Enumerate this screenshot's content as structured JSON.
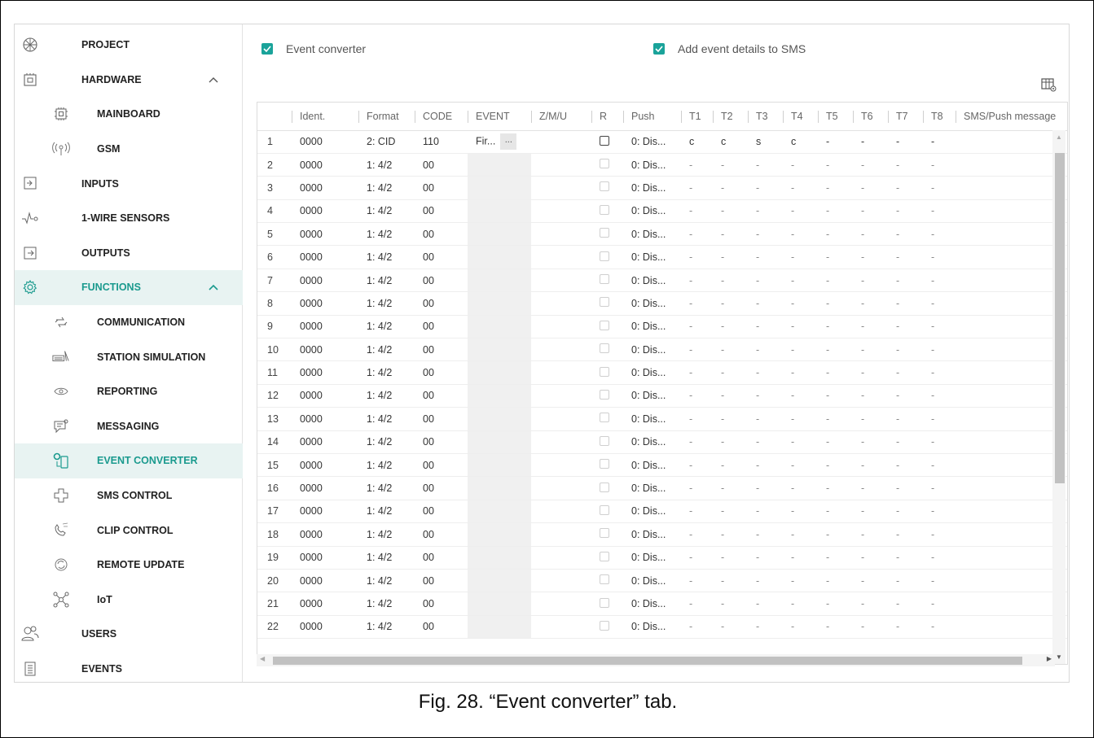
{
  "sidebar": {
    "items": [
      {
        "label": "PROJECT",
        "icon": "project-icon",
        "level": "top"
      },
      {
        "label": "HARDWARE",
        "icon": "hardware-icon",
        "level": "top",
        "expanded": true
      },
      {
        "label": "MAINBOARD",
        "icon": "mainboard-icon",
        "level": "sub"
      },
      {
        "label": "GSM",
        "icon": "gsm-antenna-icon",
        "level": "sub"
      },
      {
        "label": "INPUTS",
        "icon": "inputs-icon",
        "level": "top"
      },
      {
        "label": "1-WIRE SENSORS",
        "icon": "sensor-icon",
        "level": "top"
      },
      {
        "label": "OUTPUTS",
        "icon": "outputs-icon",
        "level": "top"
      },
      {
        "label": "FUNCTIONS",
        "icon": "gear-icon",
        "level": "top",
        "expanded": true,
        "active": true
      },
      {
        "label": "COMMUNICATION",
        "icon": "communication-icon",
        "level": "sub"
      },
      {
        "label": "STATION SIMULATION",
        "icon": "station-icon",
        "level": "sub"
      },
      {
        "label": "REPORTING",
        "icon": "eye-icon",
        "level": "sub"
      },
      {
        "label": "MESSAGING",
        "icon": "message-icon",
        "level": "sub"
      },
      {
        "label": "EVENT CONVERTER",
        "icon": "event-converter-icon",
        "level": "sub",
        "active": true
      },
      {
        "label": "SMS CONTROL",
        "icon": "sms-control-icon",
        "level": "sub"
      },
      {
        "label": "CLIP CONTROL",
        "icon": "clip-control-icon",
        "level": "sub"
      },
      {
        "label": "REMOTE UPDATE",
        "icon": "remote-update-icon",
        "level": "sub"
      },
      {
        "label": "IoT",
        "icon": "iot-icon",
        "level": "sub"
      },
      {
        "label": "USERS",
        "icon": "users-icon",
        "level": "top"
      },
      {
        "label": "EVENTS",
        "icon": "events-icon",
        "level": "top"
      }
    ]
  },
  "options": {
    "event_converter_label": "Event converter",
    "event_converter_checked": true,
    "add_details_label": "Add event details to SMS",
    "add_details_checked": true
  },
  "grid": {
    "columns": [
      "",
      "Ident.",
      "Format",
      "CODE",
      "EVENT",
      "Z/M/U",
      "R",
      "Push",
      "T1",
      "T2",
      "T3",
      "T4",
      "T5",
      "T6",
      "T7",
      "T8",
      "SMS/Push message"
    ],
    "first_row": {
      "num": "1",
      "ident": "0000",
      "format": "2: CID",
      "code": "110",
      "event": "Fir...",
      "event_btn": "...",
      "push": "0: Dis...",
      "t": [
        "c",
        "c",
        "s",
        "c",
        "-",
        "-",
        "-",
        "-"
      ]
    },
    "default_row": {
      "ident": "0000",
      "format": "1: 4/2",
      "code": "00",
      "push": "0: Dis...",
      "t": [
        "-",
        "-",
        "-",
        "-",
        "-",
        "-",
        "-",
        "-"
      ]
    },
    "row_numbers": [
      "2",
      "3",
      "4",
      "5",
      "6",
      "7",
      "8",
      "9",
      "10",
      "11",
      "12",
      "13",
      "14",
      "15",
      "16",
      "17",
      "18",
      "19",
      "20",
      "21",
      "22"
    ]
  },
  "caption": "Fig. 28. “Event converter” tab.",
  "colors": {
    "accent": "#1aa39a",
    "active_bg": "#e8f3f2"
  }
}
